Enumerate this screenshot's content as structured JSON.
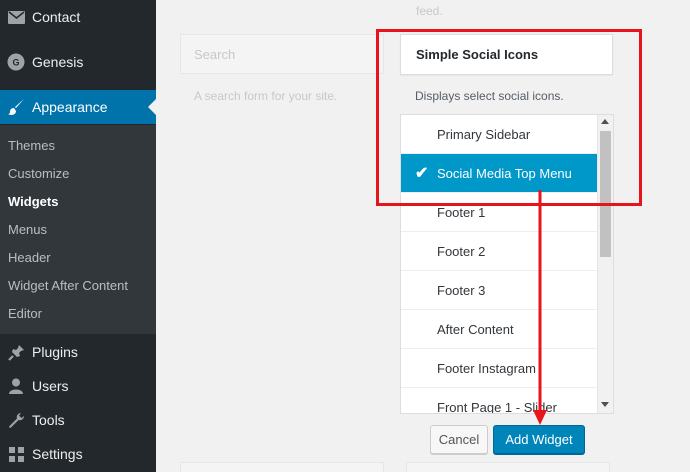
{
  "sidebar": {
    "menu": [
      {
        "label": "Contact",
        "icon": "mail-icon"
      },
      {
        "label": "Genesis",
        "icon": "genesis-icon"
      },
      {
        "label": "Appearance",
        "icon": "paintbrush-icon",
        "current": true
      },
      {
        "label": "Plugins",
        "icon": "plugin-icon"
      },
      {
        "label": "Users",
        "icon": "user-icon"
      },
      {
        "label": "Tools",
        "icon": "wrench-icon"
      },
      {
        "label": "Settings",
        "icon": "settings-icon"
      }
    ],
    "submenu": [
      {
        "label": "Themes"
      },
      {
        "label": "Customize"
      },
      {
        "label": "Widgets",
        "current": true
      },
      {
        "label": "Menus"
      },
      {
        "label": "Header"
      },
      {
        "label": "Widget After Content"
      },
      {
        "label": "Editor"
      }
    ]
  },
  "background": {
    "feed_text": "feed.",
    "search_title": "Search",
    "search_desc": "A search form for your site."
  },
  "chooser": {
    "widget_title": "Simple Social Icons",
    "widget_description": "Displays select social icons.",
    "areas": [
      {
        "label": "Primary Sidebar"
      },
      {
        "label": "Social Media Top Menu",
        "selected": true
      },
      {
        "label": "Footer 1"
      },
      {
        "label": "Footer 2"
      },
      {
        "label": "Footer 3"
      },
      {
        "label": "After Content"
      },
      {
        "label": "Footer Instagram"
      },
      {
        "label": "Front Page 1 - Slider"
      }
    ],
    "cancel_label": "Cancel",
    "add_label": "Add Widget"
  },
  "colors": {
    "sidebar_bg": "#23282d",
    "submenu_bg": "#32373c",
    "accent": "#0073aa",
    "selected_row": "#0098c8",
    "button_primary": "#0085ba",
    "annotation": "#e8141b"
  }
}
